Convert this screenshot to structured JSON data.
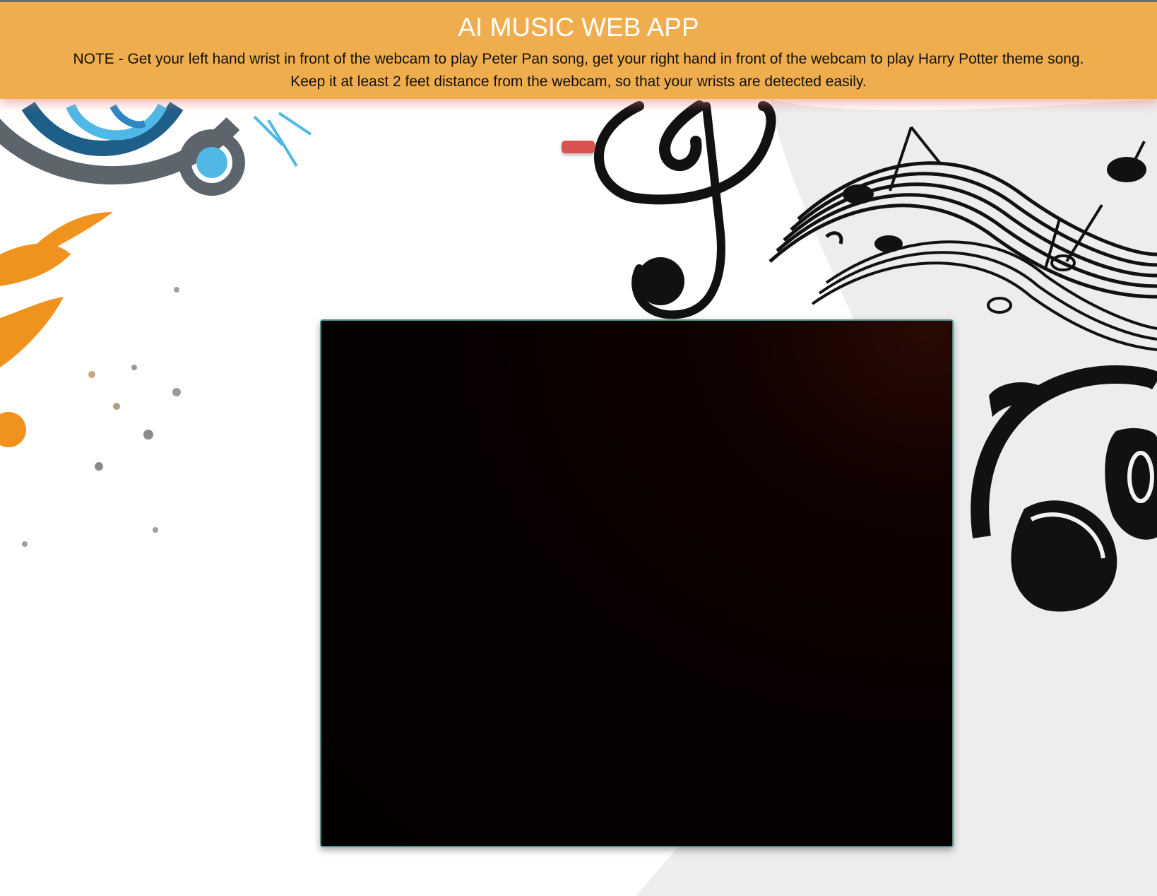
{
  "header": {
    "title": "AI MUSIC WEB APP",
    "note_line1": "NOTE - Get your left hand wrist in front of the webcam to play Peter Pan song, get your right hand in front of the webcam to play Harry Potter theme song.",
    "note_line2": "Keep it at least 2 feet distance from the webcam, so that your wrists are detected easily."
  },
  "colors": {
    "header_bg": "#f0ad4e",
    "button": "#d9534f",
    "webcam_border": "#4f8c8a"
  },
  "icons": {
    "background": [
      "music-splash-art",
      "treble-clef-icon",
      "music-notes-icon",
      "headphones-icon"
    ]
  }
}
